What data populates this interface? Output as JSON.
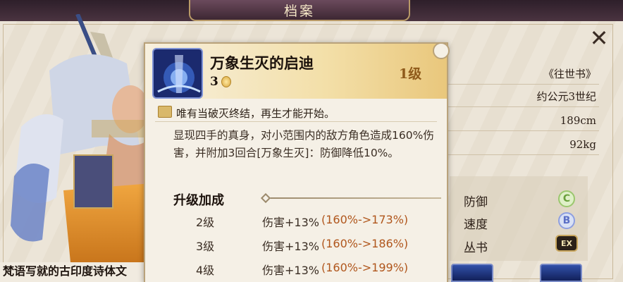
{
  "window": {
    "title": "档案"
  },
  "skill": {
    "name": "万象生灭的启迪",
    "cost": "3",
    "level": "1级",
    "quote": "唯有当破灭终结，再生才能开始。",
    "description": "显现四手的真身，对小范围内的敌方角色造成160%伤害，并附加3回合[万象生灭]：防御降低10%。"
  },
  "upgrade": {
    "title": "升级加成",
    "rows": [
      {
        "level": "2级",
        "effect": "伤害+13%",
        "range": "(160%->173%)"
      },
      {
        "level": "3级",
        "effect": "伤害+13%",
        "range": "(160%->186%)"
      },
      {
        "level": "4级",
        "effect": "伤害+13%",
        "range": "(160%->199%)"
      }
    ]
  },
  "profile": {
    "source": "《往世书》",
    "era": "约公元3世纪",
    "height": "189cm",
    "weight": "92kg"
  },
  "attributes": [
    {
      "label": "防御",
      "badge": "C",
      "color": "#6aa03c"
    },
    {
      "label": "速度",
      "badge": "B",
      "color": "#5b6fc6"
    },
    {
      "label": "丛书",
      "badge": "EX"
    }
  ],
  "caption": "梵语写就的古印度诗体文",
  "icons": {
    "close": "close-x-icon",
    "book": "book-icon",
    "coin": "coin-icon"
  }
}
